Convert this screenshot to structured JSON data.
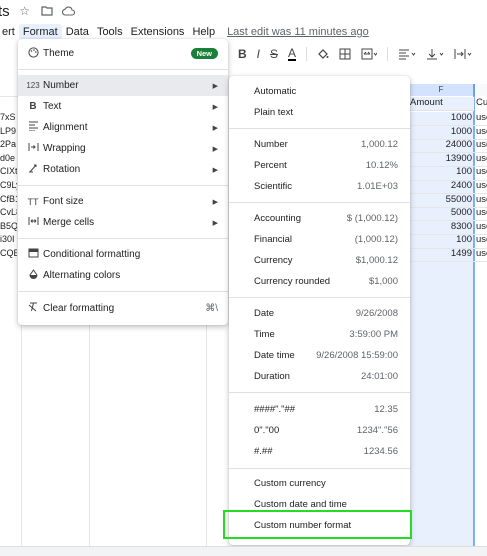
{
  "title": {
    "doc_title_partial": "ts"
  },
  "menubar": {
    "items": [
      "ert",
      "Format",
      "Data",
      "Tools",
      "Extensions",
      "Help"
    ],
    "last_edit": "Last edit was 11 minutes ago"
  },
  "toolbar": {
    "bold": "B",
    "italic": "I",
    "strike": "S",
    "text_color": "A"
  },
  "sheet": {
    "column_f_label": "F",
    "amount_header": "Amount",
    "cu_header": "Cu",
    "amounts": [
      "1000",
      "1000",
      "24000",
      "13900",
      "100",
      "2400",
      "55000",
      "5000",
      "8300",
      "100",
      "1499"
    ],
    "cu_values": [
      "usc",
      "usc",
      "usc",
      "usc",
      "usc",
      "usc",
      "usc",
      "usc",
      "usc",
      "usc",
      "usc"
    ],
    "left_fragments": [
      "7xS",
      "LP9",
      "2Pa",
      "d0e",
      "CIXt",
      "C9Ly",
      "CfB1",
      "CvL8",
      "B5Q",
      "i30I",
      "CQB"
    ]
  },
  "format_menu": {
    "theme": {
      "label": "Theme",
      "badge": "New"
    },
    "number": {
      "label": "Number",
      "icon": "123"
    },
    "text": {
      "label": "Text",
      "icon": "B"
    },
    "alignment": {
      "label": "Alignment"
    },
    "wrapping": {
      "label": "Wrapping"
    },
    "rotation": {
      "label": "Rotation"
    },
    "font_size": {
      "label": "Font size"
    },
    "merge_cells": {
      "label": "Merge cells"
    },
    "conditional_formatting": {
      "label": "Conditional formatting"
    },
    "alternating_colors": {
      "label": "Alternating colors"
    },
    "clear_formatting": {
      "label": "Clear formatting",
      "shortcut": "⌘\\"
    }
  },
  "number_menu": {
    "automatic": "Automatic",
    "plain_text": "Plain text",
    "items_group1": [
      {
        "label": "Number",
        "example": "1,000.12"
      },
      {
        "label": "Percent",
        "example": "10.12%"
      },
      {
        "label": "Scientific",
        "example": "1.01E+03"
      }
    ],
    "items_group2": [
      {
        "label": "Accounting",
        "example": "$ (1,000.12)"
      },
      {
        "label": "Financial",
        "example": "(1,000.12)"
      },
      {
        "label": "Currency",
        "example": "$1,000.12"
      },
      {
        "label": "Currency rounded",
        "example": "$1,000"
      }
    ],
    "items_group3": [
      {
        "label": "Date",
        "example": "9/26/2008"
      },
      {
        "label": "Time",
        "example": "3:59:00 PM"
      },
      {
        "label": "Date time",
        "example": "9/26/2008 15:59:00"
      },
      {
        "label": "Duration",
        "example": "24:01:00"
      }
    ],
    "items_group4": [
      {
        "label": "####\".\"##",
        "example": "12.35"
      },
      {
        "label": "0\".\"00",
        "example": "1234\".\"56"
      },
      {
        "label": "#.##",
        "example": "1234.56"
      }
    ],
    "custom_currency": "Custom currency",
    "custom_date_time": "Custom date and time",
    "custom_number_format": "Custom number format"
  },
  "colors": {
    "highlight_green": "#22dd22",
    "selection_blue": "#e8f0fe",
    "new_badge": "#188038"
  }
}
